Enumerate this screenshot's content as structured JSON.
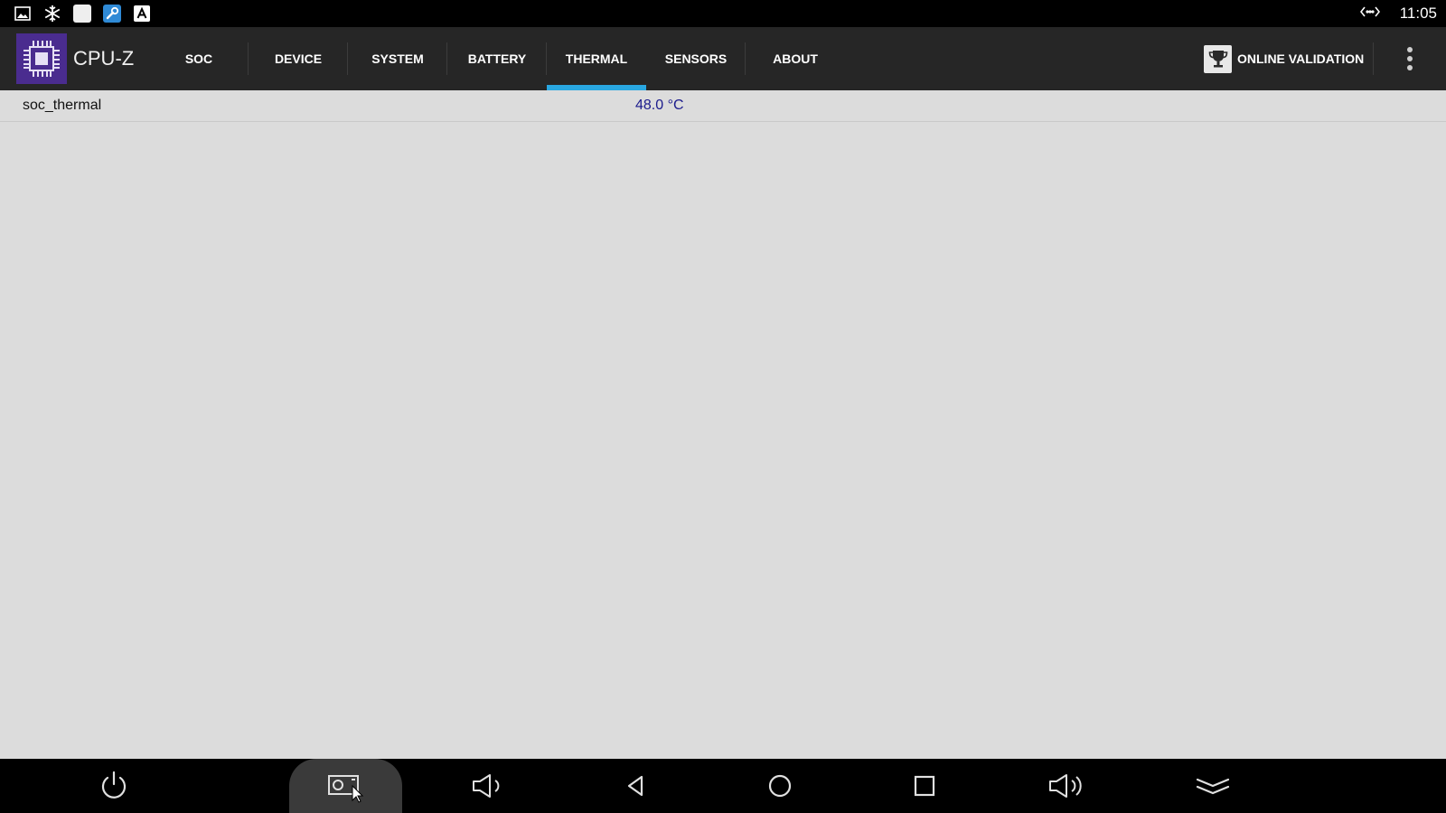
{
  "status_bar": {
    "notification_icons": [
      "image-icon",
      "snowflake-icon",
      "blank-app-icon",
      "wrench-icon",
      "font-a-icon"
    ],
    "network_icon": "ethernet-icon",
    "clock": "11:05"
  },
  "toolbar": {
    "app_name": "CPU-Z",
    "logo_icon": "cpu-chip-icon",
    "tabs": [
      {
        "label": "SOC"
      },
      {
        "label": "DEVICE"
      },
      {
        "label": "SYSTEM"
      },
      {
        "label": "BATTERY"
      },
      {
        "label": "THERMAL"
      },
      {
        "label": "SENSORS"
      },
      {
        "label": "ABOUT"
      }
    ],
    "active_tab": "THERMAL",
    "online_validation_label": "ONLINE VALIDATION",
    "online_validation_icon": "trophy-icon",
    "overflow_icon": "more-vert-icon",
    "accent_color": "#29a7e1"
  },
  "thermal": {
    "rows": [
      {
        "name": "soc_thermal",
        "value": "48.0 °C"
      }
    ]
  },
  "nav_bar": {
    "buttons": [
      "power-icon",
      "screenshot-icon",
      "volume-down-icon",
      "back-icon",
      "home-icon",
      "recents-icon",
      "volume-up-icon",
      "collapse-icon"
    ],
    "highlighted": "screenshot-icon"
  }
}
